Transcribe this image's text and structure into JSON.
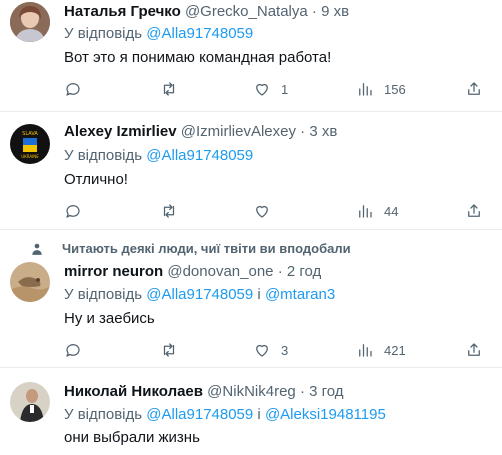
{
  "tweets": [
    {
      "name": "Наталья Гречко",
      "handle": "@Grecko_Natalya",
      "time": "9 хв",
      "reply_prefix": "У відповідь",
      "mentions": [
        "@Alla91748059"
      ],
      "text": "Вот это я понимаю командная работа!",
      "replies": "",
      "retweets": "",
      "likes": "1",
      "views": "156"
    },
    {
      "name": "Alexey Izmirliev",
      "handle": "@IzmirlievAlexey",
      "time": "3 хв",
      "reply_prefix": "У відповідь",
      "mentions": [
        "@Alla91748059"
      ],
      "text": "Отлично!",
      "replies": "",
      "retweets": "",
      "likes": "",
      "views": "44"
    },
    {
      "social_context": "Читають деякі люди, чиї твіти ви вподобали",
      "name": "mirror neuron",
      "handle": "@donovan_one",
      "time": "2 год",
      "reply_prefix": "У відповідь",
      "mentions": [
        "@Alla91748059",
        "@mtaran3"
      ],
      "joiner": "і",
      "text": "Ну и заебись",
      "replies": "",
      "retweets": "",
      "likes": "3",
      "views": "421"
    },
    {
      "name": "Николай Николаев",
      "handle": "@NikNik4reg",
      "time": "3 год",
      "reply_prefix": "У відповідь",
      "mentions": [
        "@Alla91748059",
        "@Aleksi19481195"
      ],
      "joiner": "і",
      "text": "они выбрали жизнь"
    }
  ],
  "separator": "·",
  "icons": [
    "reply-icon",
    "retweet-icon",
    "like-icon",
    "views-icon",
    "share-icon",
    "person-icon"
  ],
  "colors": {
    "accent": "#1d9bf0",
    "secondary_text": "#536471",
    "divider": "#e6ecf0"
  }
}
